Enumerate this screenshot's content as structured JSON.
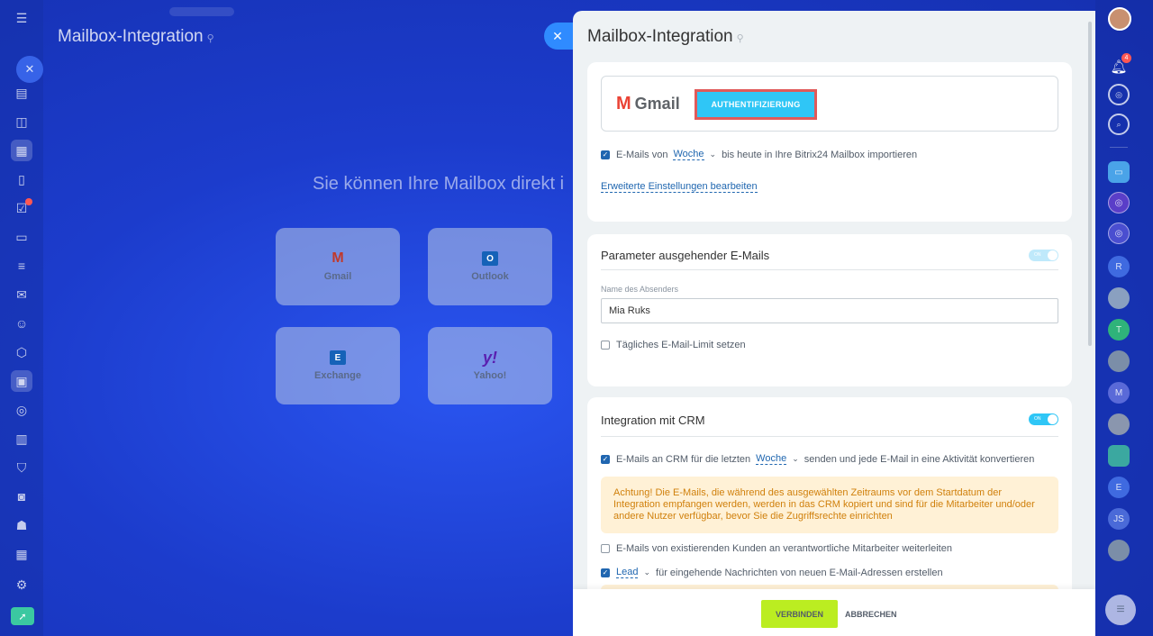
{
  "background": {
    "title": "Mailbox-Integration",
    "heading": "Sie können Ihre Mailbox direkt i",
    "tiles": [
      {
        "label": "Gmail",
        "logo": "M"
      },
      {
        "label": "Outlook",
        "logo": "O"
      },
      {
        "label": "Exchange",
        "logo": "E"
      },
      {
        "label": "Yahoo!",
        "logo": "y!"
      }
    ]
  },
  "left_sidebar": {
    "icons": [
      "menu-icon",
      "feed-icon",
      "chat-icon",
      "calendar-icon",
      "documents-icon",
      "tasks-icon",
      "crm-icon",
      "sales-icon",
      "mail-icon",
      "contacts-icon",
      "automation-icon",
      "sites-icon",
      "goals-icon",
      "analytics-icon",
      "shop-icon",
      "store-icon",
      "robot-icon",
      "inventory-icon",
      "settings-icon",
      "rocket-icon"
    ],
    "tasks_badge": "1"
  },
  "right_sidebar": {
    "notifications_count": "4",
    "avatars": [
      "R",
      "T",
      "M",
      "E",
      "JS"
    ]
  },
  "panel": {
    "title": "Mailbox-Integration",
    "gmail": {
      "logo_letter": "M",
      "logo_text": "Gmail",
      "auth_button": "AUTHENTIFIZIERUNG"
    },
    "import": {
      "prefix": "E-Mails von",
      "period": "Woche",
      "suffix": "bis heute in Ihre Bitrix24 Mailbox importieren",
      "checked": true
    },
    "advanced_link": "Erweiterte Einstellungen bearbeiten",
    "outgoing": {
      "title": "Parameter ausgehender E-Mails",
      "toggle_label": "ON",
      "sender_label": "Name des Absenders",
      "sender_value": "Mia Ruks",
      "limit_label": "Tägliches E-Mail-Limit setzen"
    },
    "crm": {
      "title": "Integration mit CRM",
      "toggle_label": "ON",
      "send_prefix": "E-Mails an CRM für die letzten",
      "send_period": "Woche",
      "send_suffix": "senden und jede E-Mail in eine Aktivität konvertieren",
      "warning": "Achtung! Die E-Mails, die während des ausgewählten Zeitraums vor dem Startdatum der Integration empfangen werden, werden in das CRM kopiert und sind für die Mitarbeiter und/oder andere Nutzer verfügbar, bevor Sie die Zugriffsrechte einrichten",
      "forward_label": "E-Mails von existierenden Kunden an verantwortliche Mitarbeiter weiterleiten",
      "lead_type": "Lead",
      "lead_suffix": "für eingehende Nachrichten von neuen E-Mail-Adressen erstellen"
    },
    "footer": {
      "connect": "VERBINDEN",
      "cancel": "ABBRECHEN"
    }
  },
  "colors": {
    "accent": "#2fc6f6",
    "connect_button": "#bbed21",
    "link": "#2067b0",
    "warning_bg": "#fff1d6",
    "warning_text": "#d0800c"
  }
}
